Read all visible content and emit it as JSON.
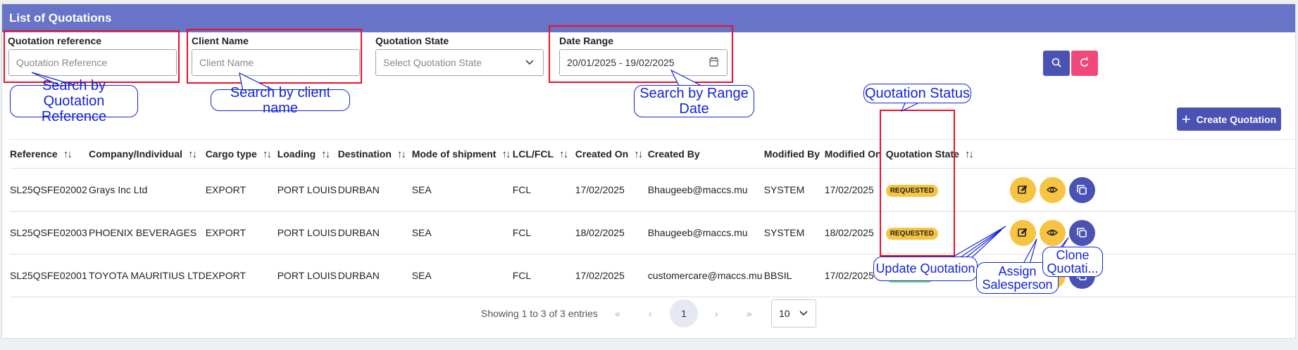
{
  "header": {
    "title": "List of Quotations"
  },
  "filters": {
    "quotation_reference": {
      "label": "Quotation reference",
      "placeholder": "Quotation Reference"
    },
    "client_name": {
      "label": "Client Name",
      "placeholder": "Client Name"
    },
    "quotation_state": {
      "label": "Quotation State",
      "placeholder": "Select Quotation State"
    },
    "date_range": {
      "label": "Date Range",
      "value": "20/01/2025 - 19/02/2025"
    }
  },
  "toolbar": {
    "search_icon": "search-icon",
    "reset_icon": "refresh-icon",
    "create_label": "Create Quotation"
  },
  "table": {
    "columns": [
      "Reference",
      "Company/Individual",
      "Cargo type",
      "Loading",
      "Destination",
      "Mode of shipment",
      "LCL/FCL",
      "Created On",
      "Created By",
      "Modified By",
      "Modified On",
      "Quotation State"
    ],
    "rows": [
      {
        "reference": "SL25QSFE02002",
        "company": "Grays Inc Ltd",
        "cargo": "EXPORT",
        "loading": "PORT LOUIS",
        "destination": "DURBAN",
        "mode": "SEA",
        "lcl": "FCL",
        "created_on": "17/02/2025",
        "created_by": "Bhaugeeb@maccs.mu",
        "modified_by": "SYSTEM",
        "modified_on": "17/02/2025",
        "state": "REQUESTED"
      },
      {
        "reference": "SL25QSFE02003",
        "company": "PHOENIX BEVERAGES",
        "cargo": "EXPORT",
        "loading": "PORT LOUIS",
        "destination": "DURBAN",
        "mode": "SEA",
        "lcl": "FCL",
        "created_on": "18/02/2025",
        "created_by": "Bhaugeeb@maccs.mu",
        "modified_by": "SYSTEM",
        "modified_on": "18/02/2025",
        "state": "REQUESTED"
      },
      {
        "reference": "SL25QSFE02001",
        "company": "TOYOTA MAURITIUS LTD",
        "cargo": "EXPORT",
        "loading": "PORT LOUIS",
        "destination": "DURBAN",
        "mode": "SEA",
        "lcl": "FCL",
        "created_on": "17/02/2025",
        "created_by": "customercare@maccs.mu",
        "modified_by": "BBSIL",
        "modified_on": "17/02/2025",
        "state": "APPROVED"
      }
    ]
  },
  "status_colors": {
    "REQUESTED": "#f6c343",
    "APPROVED": "#5fe06a"
  },
  "pagination": {
    "info": "Showing 1 to 3 of 3 entries",
    "first": "«",
    "prev": "‹",
    "current": "1",
    "next": "›",
    "last": "»",
    "page_size": "10"
  },
  "annotations": {
    "search_reference": "Search by Quotation Reference",
    "search_client": "Search by client name",
    "search_date": "Search by Range Date",
    "quotation_status": "Quotation Status",
    "update": "Update Quotation",
    "assign": "Assign Salesperson",
    "clone": "Clone Quotati..."
  }
}
